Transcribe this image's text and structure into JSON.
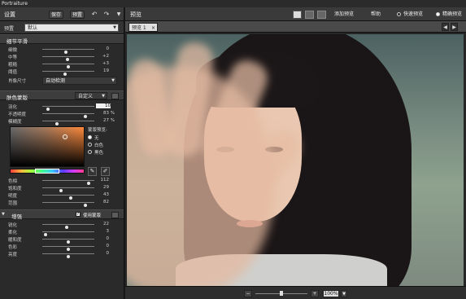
{
  "app": {
    "title": "Portraiture"
  },
  "left_panel": {
    "title": "设置",
    "save_label": "保存",
    "preset_button_label": "预置",
    "undo_icon": "undo-icon",
    "redo_icon": "redo-icon",
    "menu_icon": "menu-arrow-icon",
    "preset": {
      "label": "预置",
      "value": "默认"
    },
    "detail_section": {
      "title": "细节平滑",
      "sliders": [
        {
          "label": "细微",
          "value": "0",
          "level": 0.45
        },
        {
          "label": "中等",
          "value": "+2",
          "level": 0.47
        },
        {
          "label": "粗糙",
          "value": "+3",
          "level": 0.48
        },
        {
          "label": "阈值",
          "value": "19",
          "level": 0.42
        }
      ],
      "feature_size": {
        "label": "肖像尺寸",
        "value": "自动检测"
      }
    },
    "skin_section": {
      "title": "肤色蒙版",
      "mode_select": "自定义",
      "sliders_top": [
        {
          "label": "羽化",
          "value": "10",
          "unit": "",
          "level": 0.08
        },
        {
          "label": "不透明度",
          "value": "83",
          "unit": "%",
          "level": 0.83
        },
        {
          "label": "模糊度",
          "value": "27",
          "unit": "%",
          "level": 0.27
        }
      ],
      "mask_preview_label": "蒙版预览:",
      "mask_options": [
        "无",
        "白色",
        "黑色"
      ],
      "mask_selected": 0,
      "eyedropper_icons": [
        "eyedropper-plus-icon",
        "eyedropper-minus-icon"
      ],
      "sliders_bottom": [
        {
          "label": "色相",
          "value": "112",
          "unit": "",
          "level": 0.88
        },
        {
          "label": "饱和度",
          "value": "29",
          "unit": "",
          "level": 0.34
        },
        {
          "label": "明度",
          "value": "43",
          "unit": "",
          "level": 0.52
        },
        {
          "label": "范围",
          "value": "82",
          "unit": "",
          "level": 0.82
        }
      ]
    },
    "enhance_section": {
      "title": "增强",
      "use_mask_label": "使用蒙版",
      "use_mask_checked": true,
      "sliders": [
        {
          "label": "锐化",
          "value": "22",
          "level": 0.45
        },
        {
          "label": "柔化",
          "value": "3",
          "level": 0.05
        },
        {
          "label": "暖和度",
          "value": "0",
          "level": 0.5
        },
        {
          "label": "色彩",
          "value": "0",
          "level": 0.5
        },
        {
          "label": "亮度",
          "value": "0",
          "level": 0.5
        }
      ]
    }
  },
  "right_panel": {
    "title": "预览",
    "add_preview_label": "添加预览",
    "help_label": "帮助",
    "fast_preview_label": "快速预览",
    "precise_preview_label": "精确预览",
    "tab_label": "预览 1",
    "zoom": {
      "minus": "−",
      "plus": "+",
      "value": "100%",
      "level": 0.47
    }
  }
}
